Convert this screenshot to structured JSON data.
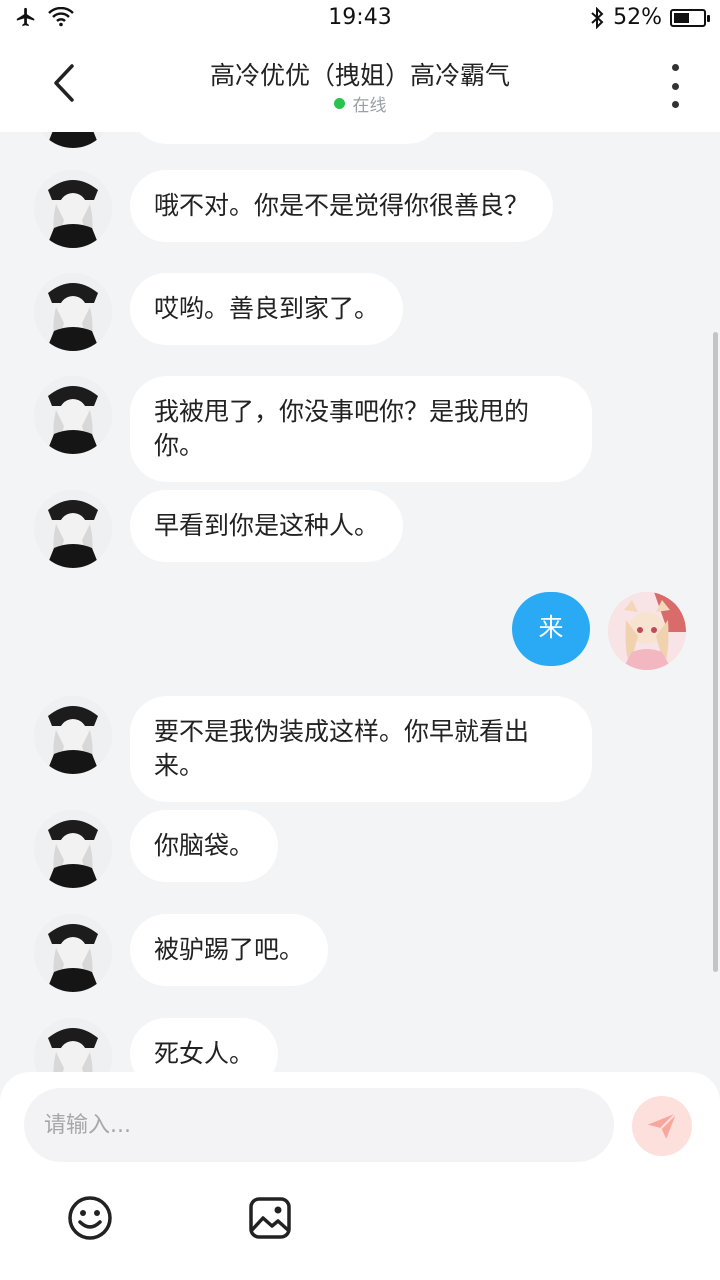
{
  "status_bar": {
    "time": "19:43",
    "battery": "52%",
    "battery_level": 0.52,
    "icons": [
      "airplane-icon",
      "wifi-icon",
      "bluetooth-icon",
      "battery-icon"
    ]
  },
  "header": {
    "title": "高冷优优（拽姐）高冷霸气",
    "status": "在线",
    "status_color": "#29c24c"
  },
  "messages": [
    {
      "from": "them",
      "text": ""
    },
    {
      "from": "them",
      "text": "哦不对。你是不是觉得你很善良？"
    },
    {
      "from": "them",
      "text": "哎哟。善良到家了。"
    },
    {
      "from": "them",
      "text": "我被甩了，你没事吧你？是我甩的你。"
    },
    {
      "from": "them",
      "text": "早看到你是这种人。"
    },
    {
      "from": "me",
      "text": "来"
    },
    {
      "from": "them",
      "text": "要不是我伪装成这样。你早就看出来。"
    },
    {
      "from": "them",
      "text": "你脑袋。"
    },
    {
      "from": "them",
      "text": "被驴踢了吧。"
    },
    {
      "from": "them",
      "text": "死女人。"
    }
  ],
  "input": {
    "placeholder": "请输入...",
    "value": ""
  },
  "colors": {
    "my_bubble": "#2aa9f4",
    "their_bubble": "#ffffff",
    "background": "#f3f4f6",
    "send_button": "#f7a79c"
  }
}
